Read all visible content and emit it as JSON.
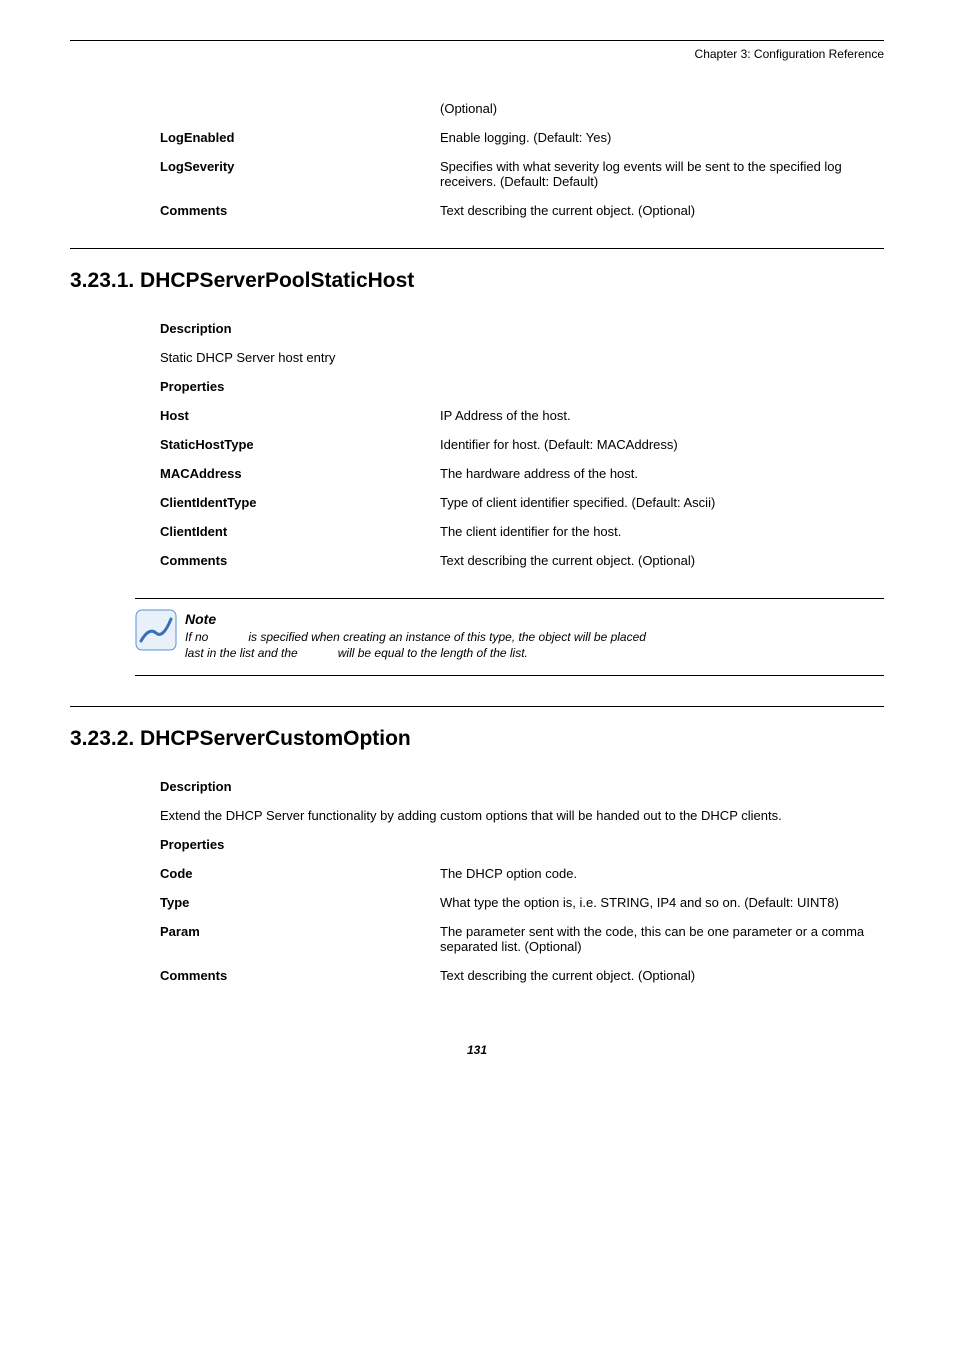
{
  "header": {
    "chapter": "Chapter 3: Configuration Reference"
  },
  "top_props": [
    {
      "label": "",
      "value": "(Optional)"
    },
    {
      "label": "LogEnabled",
      "value": "Enable logging. (Default: Yes)"
    },
    {
      "label": "LogSeverity",
      "value": "Specifies with what severity log events will be sent to the specified log receivers. (Default: Default)"
    },
    {
      "label": "Comments",
      "value": "Text describing the current object. (Optional)"
    }
  ],
  "section1": {
    "heading": "3.23.1. DHCPServerPoolStaticHost",
    "description_label": "Description",
    "description_text": "Static DHCP Server host entry",
    "properties_label": "Properties",
    "props": [
      {
        "label": "Host",
        "value": "IP Address of the host."
      },
      {
        "label": "StaticHostType",
        "value": "Identifier for host. (Default: MACAddress)"
      },
      {
        "label": "MACAddress",
        "value": "The hardware address of the host."
      },
      {
        "label": "ClientIdentType",
        "value": "Type of client identifier specified. (Default: Ascii)"
      },
      {
        "label": "ClientIdent",
        "value": "The client identifier for the host."
      },
      {
        "label": "Comments",
        "value": "Text describing the current object. (Optional)"
      }
    ],
    "note": {
      "title": "Note",
      "line1_prefix": "If no",
      "line1_rest": "is specified when creating an instance of this type, the object will be placed",
      "line2_prefix": "last in the list and the",
      "line2_rest": "will be equal to the length of the list."
    }
  },
  "section2": {
    "heading": "3.23.2. DHCPServerCustomOption",
    "description_label": "Description",
    "description_text": "Extend the DHCP Server functionality by adding custom options that will be handed out to the DHCP clients.",
    "properties_label": "Properties",
    "props": [
      {
        "label": "Code",
        "value": "The DHCP option code."
      },
      {
        "label": "Type",
        "value": "What type the option is, i.e. STRING, IP4 and so on. (Default: UINT8)"
      },
      {
        "label": "Param",
        "value": "The parameter sent with the code, this can be one parameter or a comma separated list. (Optional)"
      },
      {
        "label": "Comments",
        "value": "Text describing the current object. (Optional)"
      }
    ]
  },
  "page_number": "131"
}
